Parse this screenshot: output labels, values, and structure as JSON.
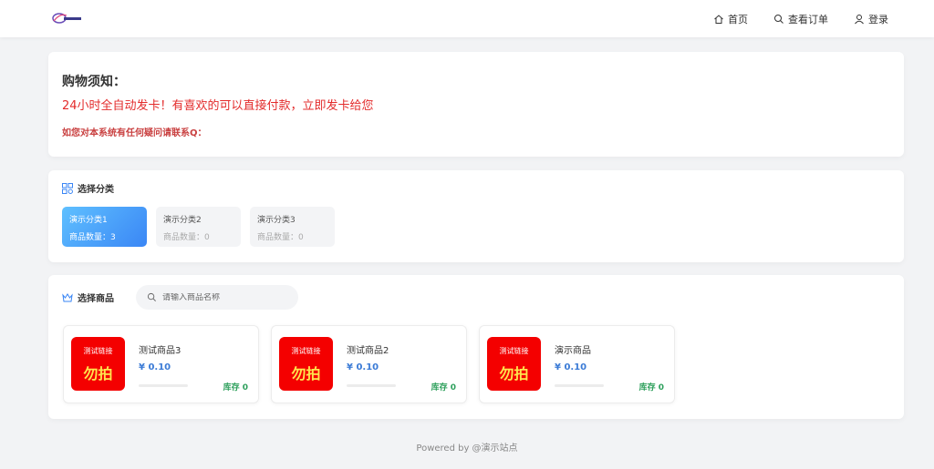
{
  "nav": {
    "home": "首页",
    "orders": "查看订单",
    "login": "登录"
  },
  "notice": {
    "title": "购物须知：",
    "line": "24小时全自动发卡！有喜欢的可以直接付款，立即发卡给您",
    "contact": "如您对本系统有任何疑问请联系Q："
  },
  "categories": {
    "heading": "选择分类",
    "items": [
      {
        "name": "演示分类1",
        "count": "商品数量：3"
      },
      {
        "name": "演示分类2",
        "count": "商品数量：0"
      },
      {
        "name": "演示分类3",
        "count": "商品数量：0"
      }
    ]
  },
  "products": {
    "heading": "选择商品",
    "search_placeholder": "请输入商品名称",
    "items": [
      {
        "thumb_top": "测试链接",
        "thumb_main": "勿拍",
        "name": "测试商品3",
        "price": "¥ 0.10",
        "stock": "库存 0",
        "stock_fraction": 0
      },
      {
        "thumb_top": "测试链接",
        "thumb_main": "勿拍",
        "name": "测试商品2",
        "price": "¥ 0.10",
        "stock": "库存 0",
        "stock_fraction": 0
      },
      {
        "thumb_top": "测试链接",
        "thumb_main": "勿拍",
        "name": "演示商品",
        "price": "¥ 0.10",
        "stock": "库存 0",
        "stock_fraction": 0
      }
    ]
  },
  "footer": "Powered by @演示站点",
  "colors": {
    "accent": "#3a86f5",
    "notice_red": "#e32b2b",
    "price_blue": "#3b7bd6",
    "stock_green": "#2ea05c",
    "thumb_red": "#f40000"
  }
}
